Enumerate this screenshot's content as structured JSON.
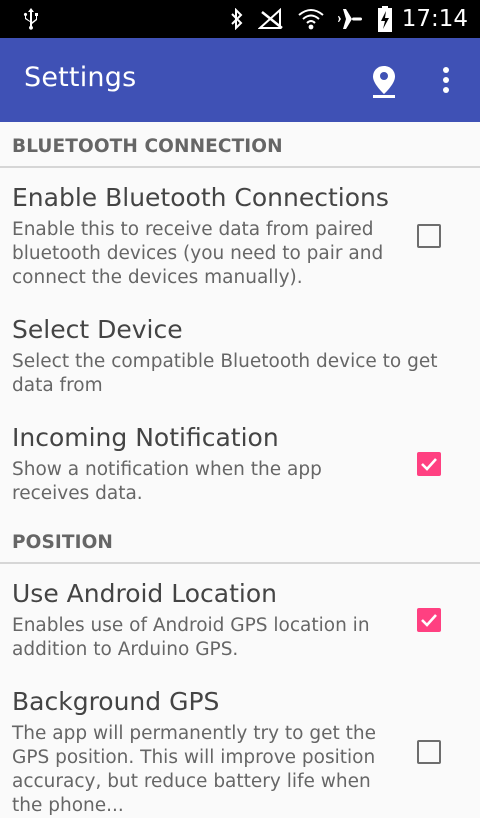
{
  "status_bar": {
    "time": "17:14",
    "icons": [
      "usb-icon",
      "bluetooth-icon",
      "no-signal-icon",
      "wifi-icon",
      "airplane-icon",
      "battery-charging-icon"
    ]
  },
  "app_bar": {
    "title": "Settings",
    "actions": [
      "location-icon",
      "more-vert-icon"
    ],
    "color": "#3f51b5"
  },
  "accent_color": "#ff4081",
  "sections": [
    {
      "header": "BLUETOOTH CONNECTION",
      "prefs": [
        {
          "title": "Enable Bluetooth Connections",
          "summary": "Enable this to receive data from paired bluetooth devices (you need to pair and connect the devices manually).",
          "checked": false
        },
        {
          "title": "Select Device",
          "summary": "Select the compatible Bluetooth device to get data from"
        },
        {
          "title": "Incoming Notification",
          "summary": "Show a notification when the app receives data.",
          "checked": true
        }
      ]
    },
    {
      "header": "POSITION",
      "prefs": [
        {
          "title": "Use Android Location",
          "summary": "Enables use of Android GPS location in addition to Arduino GPS.",
          "checked": true
        },
        {
          "title": "Background GPS",
          "summary": "The app will permanently try to get the GPS position. This will improve position accuracy, but reduce battery life when the phone...",
          "checked": false
        }
      ]
    }
  ]
}
